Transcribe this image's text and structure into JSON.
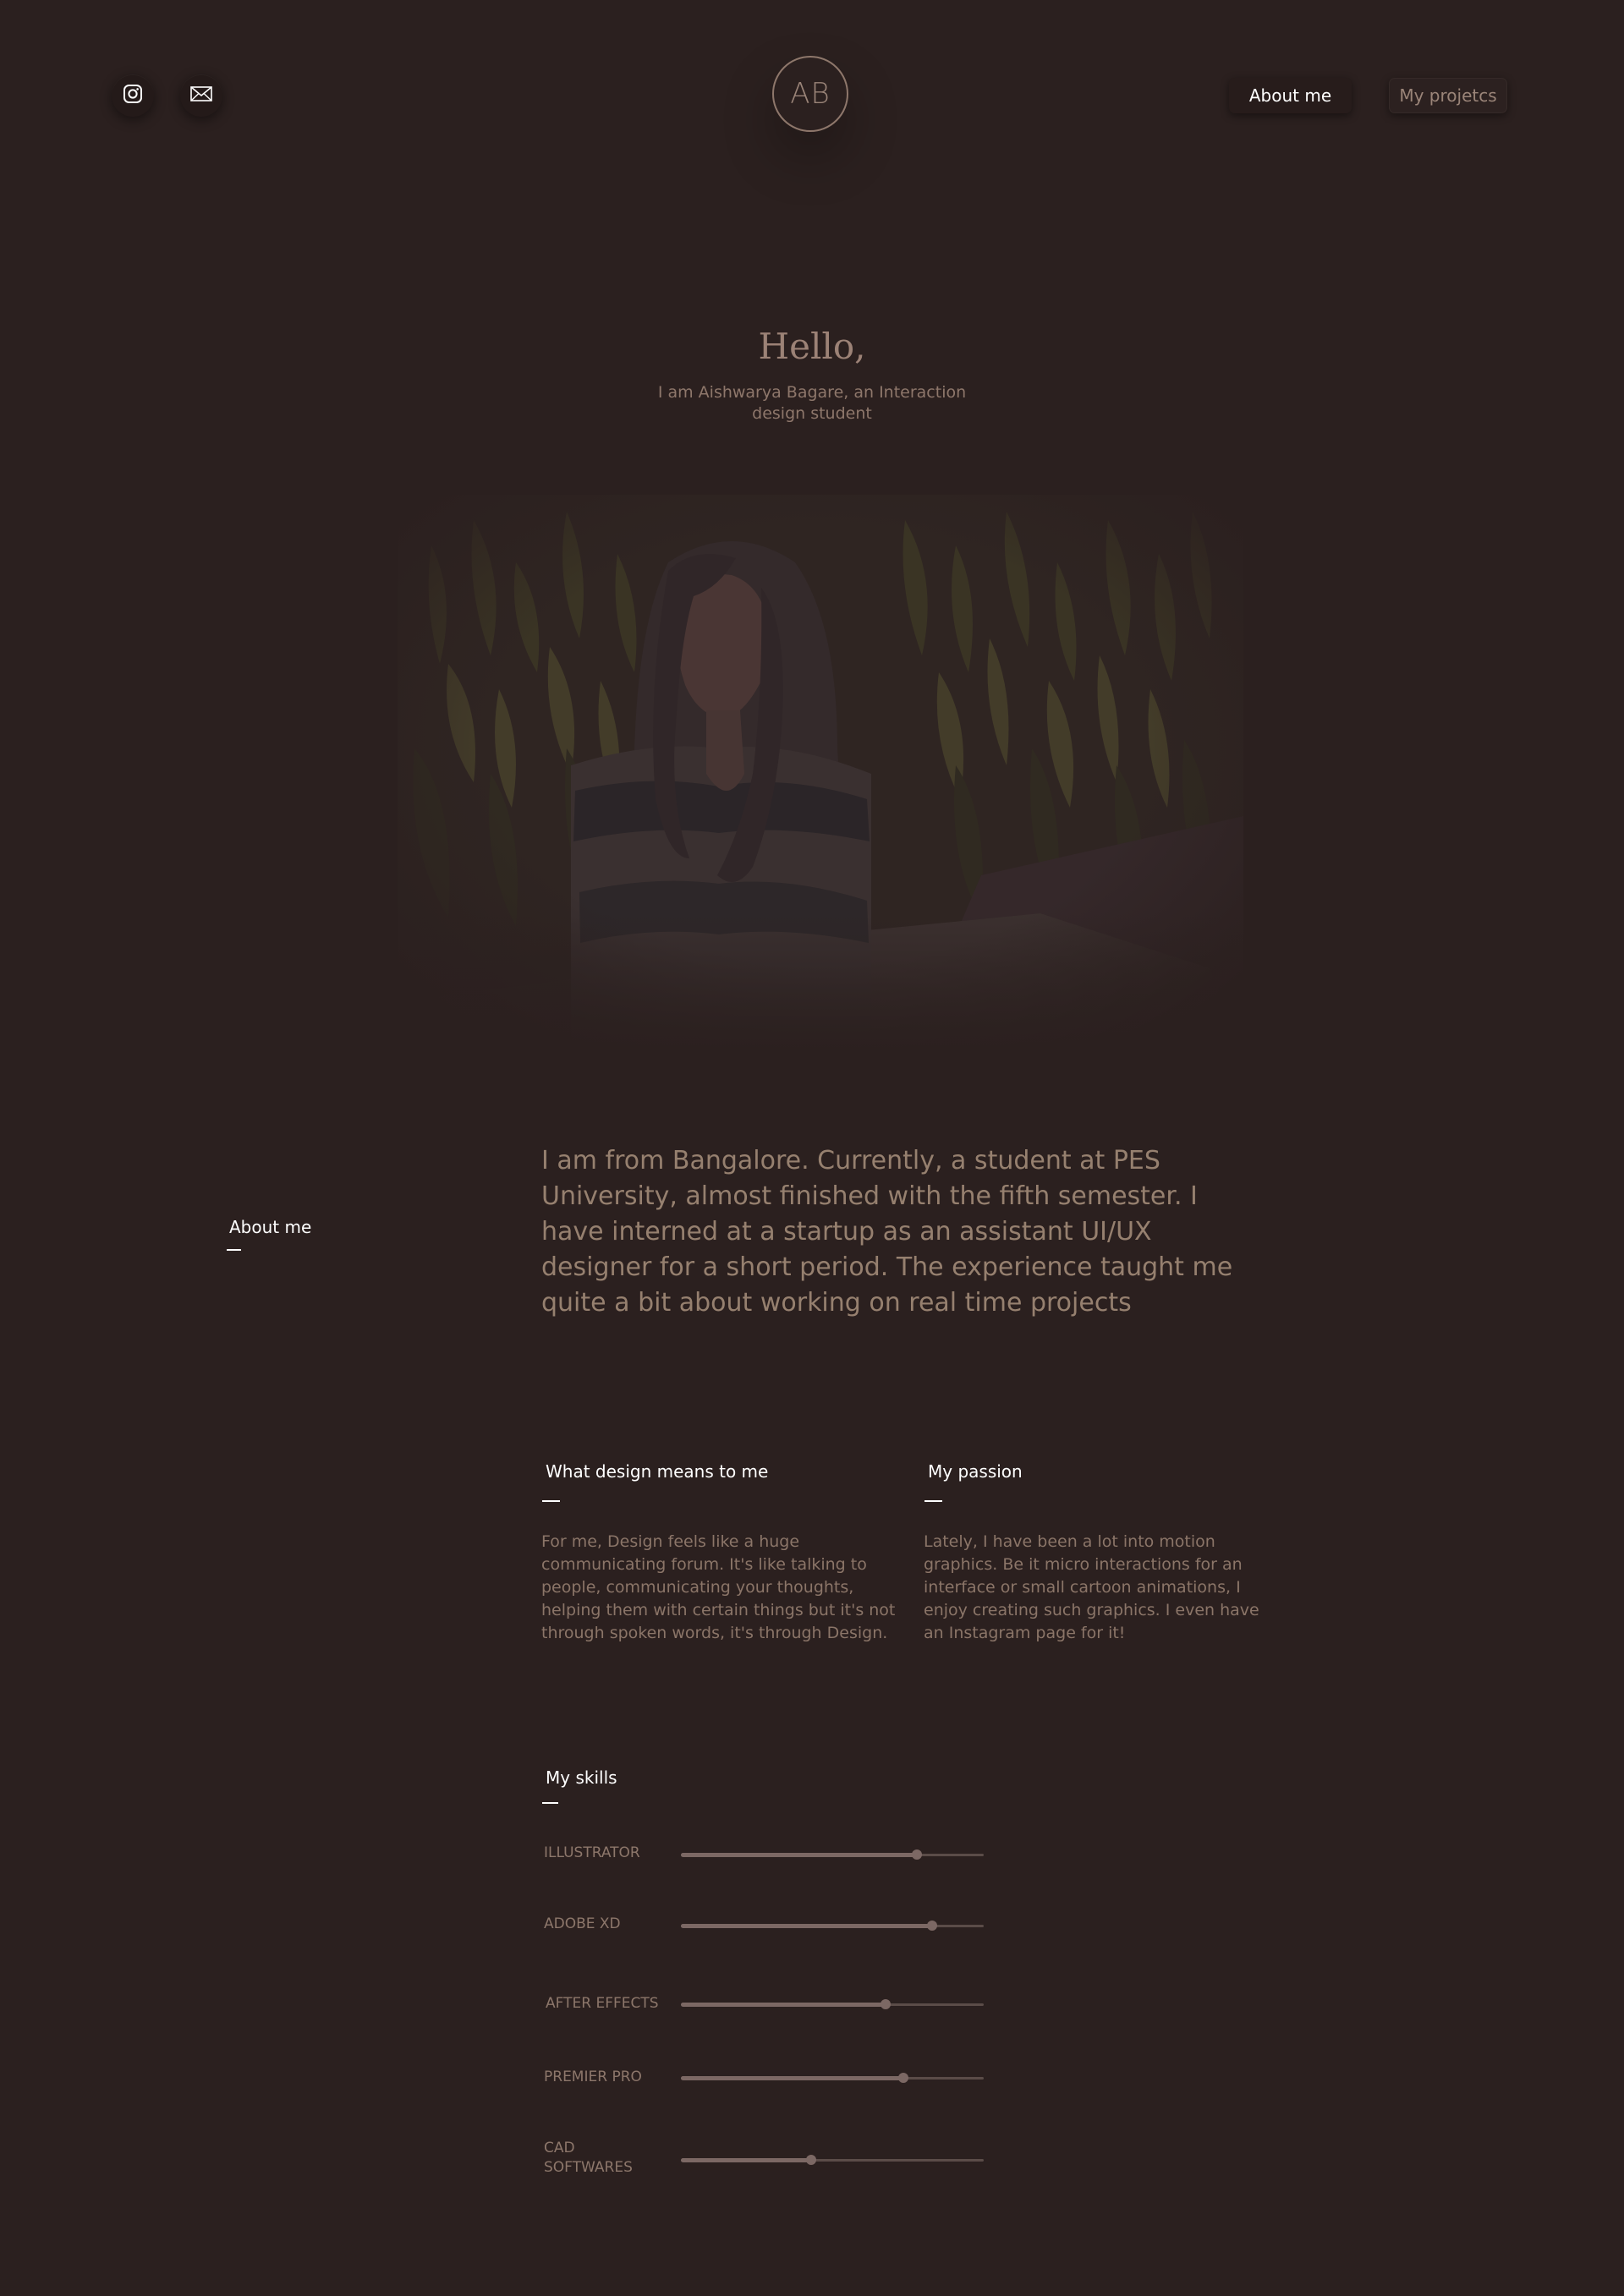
{
  "header": {
    "logo_text": "AB",
    "social": [
      {
        "icon": "instagram-icon"
      },
      {
        "icon": "mail-icon"
      }
    ],
    "nav": {
      "about": "About me",
      "projects": "My projetcs"
    }
  },
  "hero": {
    "greeting": "Hello,",
    "intro": "I am Aishwarya Bagare, an Interaction design student"
  },
  "about": {
    "label": "About me",
    "text": "I am from Bangalore. Currently, a student at PES University, almost finished with the fifth semester. I have interned at a startup as an assistant UI/UX designer for a short period. The experience taught me quite a bit about working on real time projects"
  },
  "design": {
    "title": "What design means to me",
    "text": "For me, Design feels like a huge communicating forum. It's like talking to people, communicating your thoughts, helping them with certain things but it's not through spoken words, it's through Design."
  },
  "passion": {
    "title": "My passion",
    "text": "Lately, I have been a lot into motion graphics. Be it micro interactions for an interface or small cartoon animations, I enjoy creating such graphics. I even have an Instagram page for it!"
  },
  "skills": {
    "title": "My skills",
    "items": [
      {
        "name": "ILLUSTRATOR",
        "level": 0.78
      },
      {
        "name": "ADOBE XD",
        "level": 0.83
      },
      {
        "name": "AFTER EFFECTS",
        "level": 0.675
      },
      {
        "name": "PREMIER PRO",
        "level": 0.735
      },
      {
        "name": "CAD SOFTWARES",
        "level": 0.43
      }
    ]
  },
  "colors": {
    "background": "#2b201f",
    "accent_text": "#9a8478",
    "heading": "#ffffff"
  }
}
